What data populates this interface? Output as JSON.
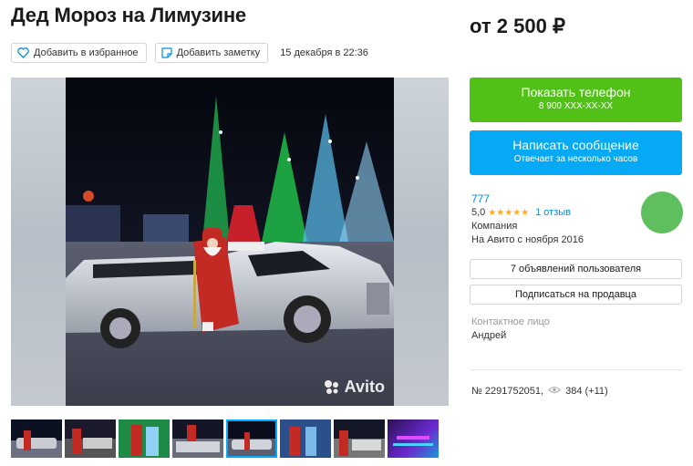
{
  "listing": {
    "title": "Дед Мороз на Лимузине",
    "price": "от 2 500 ₽",
    "date": "15 декабря в 22:36",
    "add_favorite_label": "Добавить в избранное",
    "add_note_label": "Добавить заметку",
    "watermark": "Avito",
    "thumbnail_count": 8,
    "active_thumbnail": 5
  },
  "actions": {
    "phone_label": "Показать телефон",
    "phone_number": "8 900 XXX-XX-XX",
    "message_label": "Написать сообщение",
    "message_sub": "Отвечает за несколько часов"
  },
  "seller": {
    "name": "777",
    "rating": "5,0",
    "stars": "★★★★★",
    "reviews": "1 отзыв",
    "type": "Компания",
    "since": "На Авито с ноября 2016",
    "ads_button": "7 объявлений пользователя",
    "subscribe_button": "Подписаться на продавца",
    "contact_label": "Контактное лицо",
    "contact_name": "Андрей"
  },
  "meta": {
    "ad_number": "№ 2291752051,",
    "views": "384 (+11)"
  },
  "colors": {
    "phone_button": "#52c117",
    "message_button": "#06a9f5",
    "link": "#0091d9",
    "star": "#ffa926",
    "avatar": "#5fbf5f"
  }
}
